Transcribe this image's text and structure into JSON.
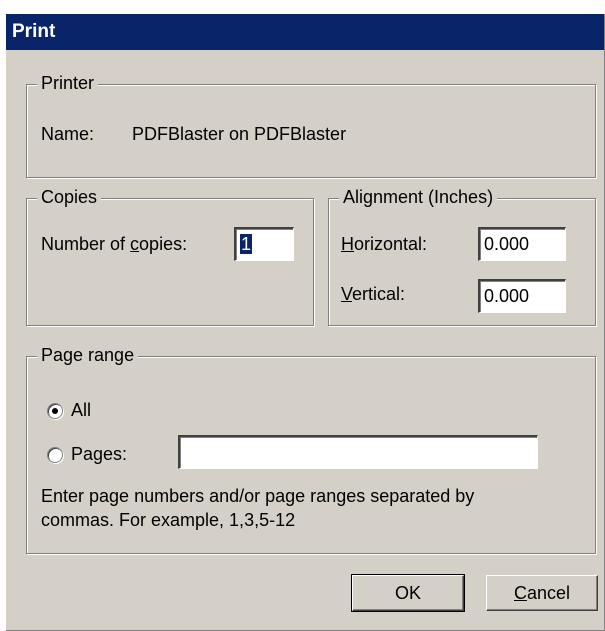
{
  "window": {
    "title": "Print"
  },
  "printer": {
    "legend": "Printer",
    "name_label": "Name:",
    "name_value": "PDFBlaster on PDFBlaster"
  },
  "copies": {
    "legend": "Copies",
    "label_pre": "Number of ",
    "label_accel": "c",
    "label_post": "opies:",
    "value": "1"
  },
  "alignment": {
    "legend": "Alignment (Inches)",
    "horizontal_accel": "H",
    "horizontal_rest": "orizontal:",
    "horizontal_value": "0.000",
    "vertical_accel": "V",
    "vertical_rest": "ertical:",
    "vertical_value": "0.000"
  },
  "page_range": {
    "legend": "Page range",
    "all_label": "All",
    "pages_label": "Pages:",
    "pages_value": "",
    "selected": "All",
    "hint_line1": "Enter page numbers and/or page ranges separated by",
    "hint_line2": "commas.  For example, 1,3,5-12"
  },
  "buttons": {
    "ok_label": "OK",
    "cancel_accel": "C",
    "cancel_rest": "ancel"
  }
}
